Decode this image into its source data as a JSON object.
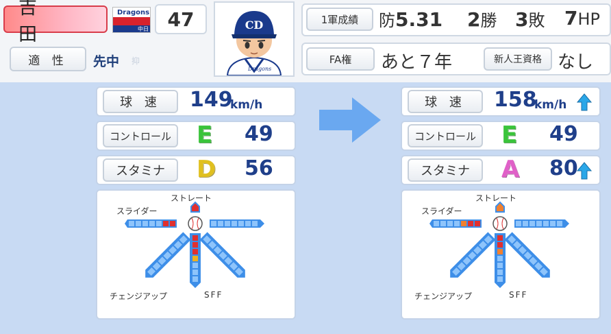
{
  "player": {
    "name": "吉 田",
    "team_logo_text": "Dragons",
    "team_logo_sub": "中日",
    "number": "47",
    "cap_logo": "CD",
    "aptitude_label": "適 性",
    "aptitude_value": "先中",
    "aptitude_sub": "抑"
  },
  "record": {
    "label": "1軍成績",
    "era_prefix": "防",
    "era": "5.31",
    "wins_value": "2",
    "wins_unit": "勝",
    "losses_value": "3",
    "losses_unit": "敗",
    "hp_value": "7",
    "hp_unit": "HP"
  },
  "fa": {
    "label": "FA権",
    "value": "あと７年",
    "rookie_label": "新人王資格",
    "rookie_value": "なし"
  },
  "before": {
    "speed_label": "球 速",
    "speed_value": "149",
    "speed_unit": "km/h",
    "control_label": "コントロール",
    "control_grade": "E",
    "control_value": "49",
    "stamina_label": "スタミナ",
    "stamina_grade": "D",
    "stamina_value": "56",
    "pitches": {
      "straight": "ストレート",
      "slider": "スライダー",
      "change": "チェンジアップ",
      "sff": "SFF",
      "slider_level": 2,
      "sff_level": 4,
      "slider_colors": [
        "#e03030",
        "#e03030"
      ],
      "sff_colors": [
        "#e03030",
        "#e03030",
        "#e03030",
        "#f0b020"
      ],
      "straight_color": "#e03030"
    }
  },
  "after": {
    "speed_label": "球 速",
    "speed_value": "158",
    "speed_unit": "km/h",
    "control_label": "コントロール",
    "control_grade": "E",
    "control_value": "49",
    "stamina_label": "スタミナ",
    "stamina_grade": "A",
    "stamina_value": "80",
    "pitches": {
      "straight": "ストレート",
      "slider": "スライダー",
      "change": "チェンジアップ",
      "sff": "SFF",
      "slider_level": 3,
      "sff_level": 3,
      "slider_colors": [
        "#e03030",
        "#e03030",
        "#f08030"
      ],
      "sff_colors": [
        "#e03030",
        "#e03030",
        "#f08030"
      ],
      "straight_color": "#f08030"
    }
  },
  "colors": {
    "accent_arrow": "#6aa8f0",
    "up_arrow": "#2aa7e8",
    "bar_blue": "#3d8ee8",
    "bar_inner": "#8ec4fb"
  },
  "icons": {
    "transition": "right-arrow-icon",
    "increase": "up-arrow-icon"
  }
}
